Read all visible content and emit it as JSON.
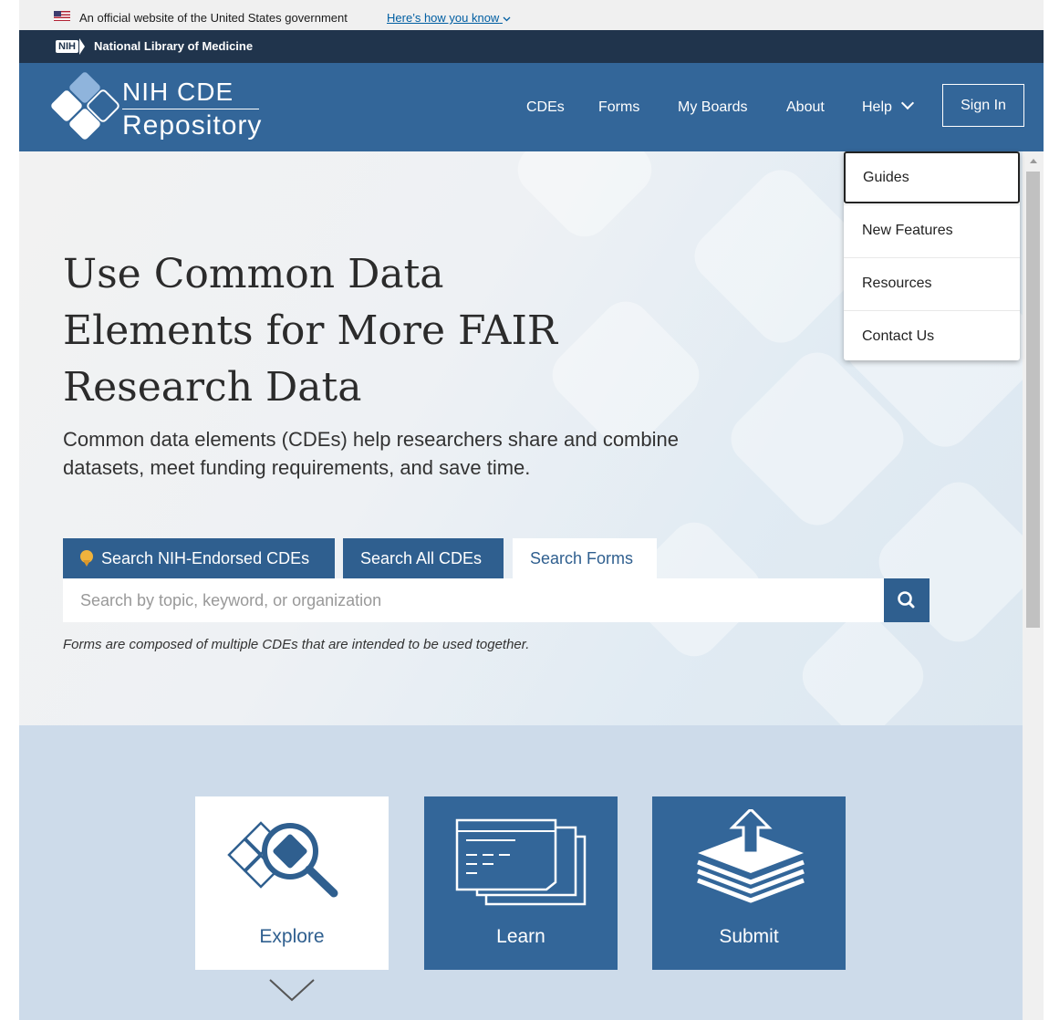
{
  "gov_banner": {
    "text": "An official website of the United States government",
    "link": "Here’s how you know"
  },
  "nlm_bar": {
    "badge": "NIH",
    "title": "National Library of Medicine"
  },
  "header": {
    "logo_line1": "NIH CDE",
    "logo_line2": "Repository",
    "nav": {
      "cdes": "CDEs",
      "forms": "Forms",
      "my_boards": "My Boards",
      "about": "About",
      "help": "Help"
    },
    "sign_in": "Sign In"
  },
  "help_menu": {
    "items": [
      "Guides",
      "New Features",
      "Resources",
      "Contact Us"
    ],
    "focused": "Guides"
  },
  "hero": {
    "title": "Use Common Data Elements for More FAIR Research Data",
    "subtitle": "Common data elements (CDEs) help researchers share and combine datasets, meet funding requirements, and save time."
  },
  "search": {
    "tabs": [
      "Search NIH-Endorsed CDEs",
      "Search All CDEs",
      "Search Forms"
    ],
    "active_tab": "Search Forms",
    "placeholder": "Search by topic, keyword, or organization",
    "value": "",
    "hint": "Forms are composed of multiple CDEs that are intended to be used together."
  },
  "cards": {
    "explore": "Explore",
    "learn": "Learn",
    "submit": "Submit"
  },
  "icons": {
    "flag": "us-flag-icon",
    "award": "award-ribbon-icon",
    "search": "search-icon",
    "help_chevron": "chevron-down-icon",
    "explore": "magnifier-icon",
    "learn": "documents-icon",
    "submit": "upload-stack-icon",
    "scroll_down": "chevron-down-icon"
  },
  "colors": {
    "header": "#336699",
    "nlm_bar": "#20344c",
    "tab_dark": "#2f5f8f",
    "lower_band": "#cddbea"
  }
}
